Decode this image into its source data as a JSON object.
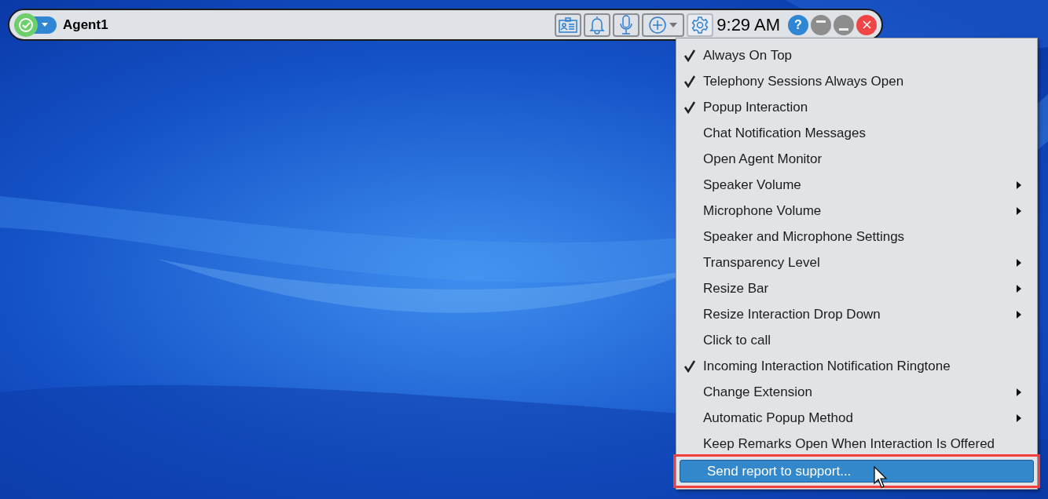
{
  "toolbar": {
    "agent_name": "Agent1",
    "time": "9:29 AM",
    "help": "?",
    "settings_selected": true
  },
  "menu": {
    "items": [
      {
        "label": "Always On Top",
        "checked": true,
        "submenu": false,
        "selected": false
      },
      {
        "label": "Telephony Sessions Always Open",
        "checked": true,
        "submenu": false,
        "selected": false
      },
      {
        "label": "Popup Interaction",
        "checked": true,
        "submenu": false,
        "selected": false
      },
      {
        "label": "Chat Notification Messages",
        "checked": false,
        "submenu": false,
        "selected": false
      },
      {
        "label": "Open Agent Monitor",
        "checked": false,
        "submenu": false,
        "selected": false
      },
      {
        "label": "Speaker Volume",
        "checked": false,
        "submenu": true,
        "selected": false
      },
      {
        "label": "Microphone Volume",
        "checked": false,
        "submenu": true,
        "selected": false
      },
      {
        "label": "Speaker and Microphone Settings",
        "checked": false,
        "submenu": false,
        "selected": false
      },
      {
        "label": "Transparency Level",
        "checked": false,
        "submenu": true,
        "selected": false
      },
      {
        "label": "Resize Bar",
        "checked": false,
        "submenu": true,
        "selected": false
      },
      {
        "label": "Resize Interaction Drop Down",
        "checked": false,
        "submenu": true,
        "selected": false
      },
      {
        "label": "Click to call",
        "checked": false,
        "submenu": false,
        "selected": false
      },
      {
        "label": "Incoming Interaction Notification Ringtone",
        "checked": true,
        "submenu": false,
        "selected": false
      },
      {
        "label": "Change Extension",
        "checked": false,
        "submenu": true,
        "selected": false
      },
      {
        "label": "Automatic Popup Method",
        "checked": false,
        "submenu": true,
        "selected": false
      },
      {
        "label": "Keep Remarks Open When Interaction Is Offered",
        "checked": false,
        "submenu": false,
        "selected": false
      },
      {
        "label": "Send report to support...",
        "checked": false,
        "submenu": false,
        "selected": true
      }
    ]
  }
}
